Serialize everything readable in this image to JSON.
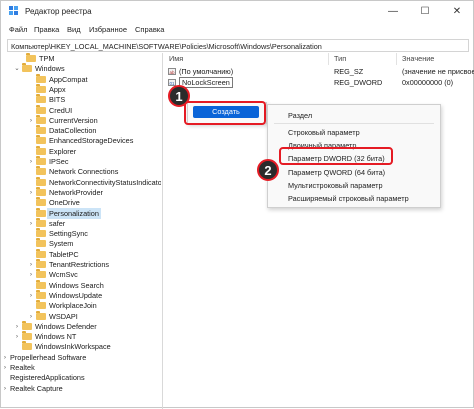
{
  "titlebar": {
    "title": "Редактор реестра",
    "minimize": "—",
    "maximize": "☐",
    "close": "✕"
  },
  "menu": {
    "file": "Файл",
    "edit": "Правка",
    "view": "Вид",
    "favorites": "Избранное",
    "help": "Справка"
  },
  "address": "Компьютер\\HKEY_LOCAL_MACHINE\\SOFTWARE\\Policies\\Microsoft\\Windows\\Personalization",
  "tree": [
    {
      "label": "TPM",
      "chev": "",
      "folder": true
    },
    {
      "label": "Windows",
      "chev": "⌄",
      "folder": true
    },
    {
      "label": "AppCompat",
      "chev": "",
      "folder": true
    },
    {
      "label": "Appx",
      "chev": "",
      "folder": true
    },
    {
      "label": "BITS",
      "chev": "",
      "folder": true
    },
    {
      "label": "CredUI",
      "chev": "",
      "folder": true
    },
    {
      "label": "CurrentVersion",
      "chev": "›",
      "folder": true
    },
    {
      "label": "DataCollection",
      "chev": "",
      "folder": true
    },
    {
      "label": "EnhancedStorageDevices",
      "chev": "",
      "folder": true
    },
    {
      "label": "Explorer",
      "chev": "",
      "folder": true
    },
    {
      "label": "IPSec",
      "chev": "›",
      "folder": true
    },
    {
      "label": "Network Connections",
      "chev": "",
      "folder": true
    },
    {
      "label": "NetworkConnectivityStatusIndicator",
      "chev": "",
      "folder": true
    },
    {
      "label": "NetworkProvider",
      "chev": "›",
      "folder": true
    },
    {
      "label": "OneDrive",
      "chev": "",
      "folder": true
    },
    {
      "label": "Personalization",
      "chev": "",
      "folder": true,
      "selected": true
    },
    {
      "label": "safer",
      "chev": "›",
      "folder": true
    },
    {
      "label": "SettingSync",
      "chev": "",
      "folder": true
    },
    {
      "label": "System",
      "chev": "",
      "folder": true
    },
    {
      "label": "TabletPC",
      "chev": "",
      "folder": true
    },
    {
      "label": "TenantRestrictions",
      "chev": "›",
      "folder": true
    },
    {
      "label": "WcmSvc",
      "chev": "›",
      "folder": true
    },
    {
      "label": "Windows Search",
      "chev": "",
      "folder": true
    },
    {
      "label": "WindowsUpdate",
      "chev": "›",
      "folder": true
    },
    {
      "label": "WorkplaceJoin",
      "chev": "",
      "folder": true
    },
    {
      "label": "WSDAPI",
      "chev": "›",
      "folder": true
    },
    {
      "label": "Windows Defender",
      "chev": "›",
      "folder": true
    },
    {
      "label": "Windows NT",
      "chev": "›",
      "folder": true
    },
    {
      "label": "WindowsInkWorkspace",
      "chev": "",
      "folder": true
    },
    {
      "label": "Propellerhead Software",
      "chev": "›",
      "folder": false
    },
    {
      "label": "Realtek",
      "chev": "›",
      "folder": false
    },
    {
      "label": "RegisteredApplications",
      "chev": "",
      "folder": false
    },
    {
      "label": "Realtek Capture",
      "chev": "›",
      "folder": false
    }
  ],
  "values_pane": {
    "headers": {
      "name": "Имя",
      "type": "Тип",
      "data": "Значение"
    },
    "rows": [
      {
        "icon": "ab",
        "name": "(По умолчанию)",
        "type": "REG_SZ",
        "data": "(значение не присвоено)"
      },
      {
        "icon": "01",
        "name": "NoLockScreen",
        "type": "REG_DWORD",
        "data": "0x00000000 (0)"
      }
    ]
  },
  "create_button": "Создать",
  "submenu": {
    "items": [
      "Раздел",
      "Строковый параметр",
      "Двоичный параметр",
      "Параметр DWORD (32 бита)",
      "Параметр QWORD (64 бита)",
      "Мультистроковый параметр",
      "Расширяемый строковый параметр"
    ]
  },
  "steps": [
    "1",
    "2"
  ],
  "colors": {
    "accent": "#0a64d8",
    "highlight": "#e51b24",
    "selection": "#cce4f7",
    "folder": "#f2c35c"
  }
}
